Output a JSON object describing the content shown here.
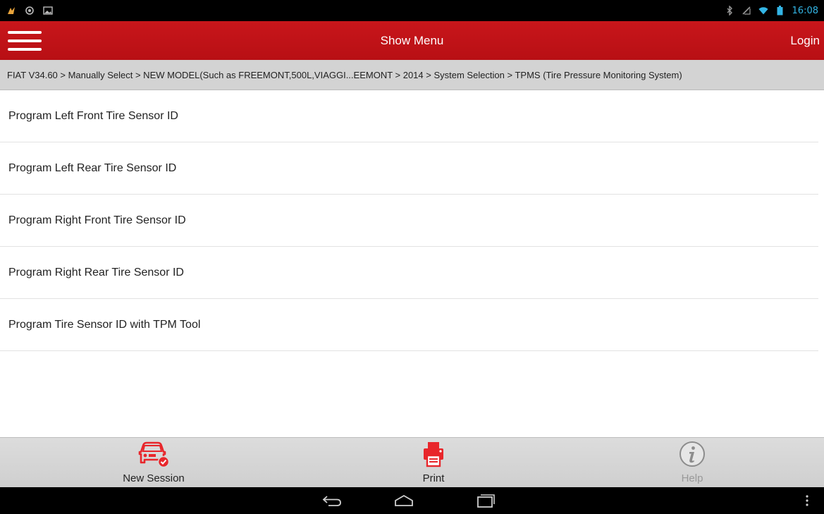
{
  "status_bar": {
    "time": "16:08",
    "left_icons": [
      "notification-app-icon",
      "location-icon",
      "image-icon"
    ],
    "right_icons": [
      "bluetooth-icon",
      "signal-off-icon",
      "wifi-icon",
      "battery-icon"
    ]
  },
  "header": {
    "title": "Show Menu",
    "login_label": "Login"
  },
  "breadcrumb": {
    "text": "FIAT V34.60 > Manually Select > NEW MODEL(Such as FREEMONT,500L,VIAGGI...EEMONT > 2014 > System Selection > TPMS (Tire Pressure Monitoring System)"
  },
  "menu": {
    "items": [
      {
        "label": "Program Left Front Tire Sensor ID"
      },
      {
        "label": "Program Left Rear Tire Sensor ID"
      },
      {
        "label": "Program Right Front Tire Sensor ID"
      },
      {
        "label": "Program Right Rear Tire Sensor ID"
      },
      {
        "label": "Program Tire Sensor ID with TPM Tool"
      }
    ]
  },
  "toolbar": {
    "new_session_label": "New Session",
    "print_label": "Print",
    "help_label": "Help"
  },
  "colors": {
    "header_red": "#c8161b",
    "icon_red": "#e8262b",
    "status_blue": "#33b5e5"
  }
}
